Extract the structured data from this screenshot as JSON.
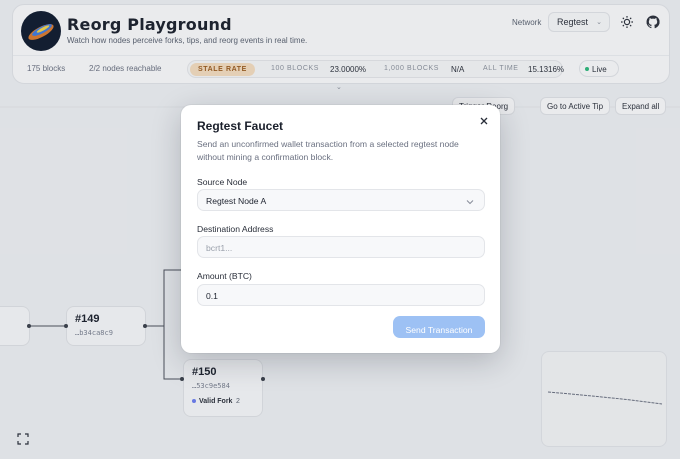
{
  "app": {
    "title": "Reorg Playground",
    "subtitle": "Watch how nodes perceive forks, tips, and reorg events in real time.",
    "network_label": "Network",
    "network_value": "Regtest"
  },
  "stats": {
    "blocks": "175 blocks",
    "nodes": "2/2 nodes reachable",
    "stale_rate_label": "STALE RATE",
    "last100_label": "100 BLOCKS",
    "last100_value": "23.0000%",
    "last1000_label": "1,000 BLOCKS",
    "last1000_value": "N/A",
    "all_time_label": "ALL TIME",
    "all_time_value": "15.1316%",
    "live_label": "Live"
  },
  "toolbar": {
    "trigger_reorg": "Trigger Reorg",
    "go_to_tip": "Go to Active Tip",
    "expand_all": "Expand all"
  },
  "blocks": [
    {
      "height": "#149",
      "hash": "…b34ca8c9"
    },
    {
      "height": "#150",
      "hash": "…53c9e584",
      "status": "Valid Fork",
      "count": "2"
    }
  ],
  "modal": {
    "title": "Regtest Faucet",
    "description": "Send an unconfirmed wallet transaction from a selected regtest node without mining a confirmation block.",
    "source_label": "Source Node",
    "source_value": "Regtest Node A",
    "dest_label": "Destination Address",
    "dest_placeholder": "bcrt1...",
    "amount_label": "Amount (BTC)",
    "amount_value": "0.1",
    "send_label": "Send Transaction"
  },
  "colors": {
    "accent": "#9dc1f4",
    "stale_tag_bg": "#f4dcbf",
    "stale_tag_text": "#9a5b1e",
    "live_dot": "#2db87a",
    "fork_dot": "#6b7df0"
  }
}
